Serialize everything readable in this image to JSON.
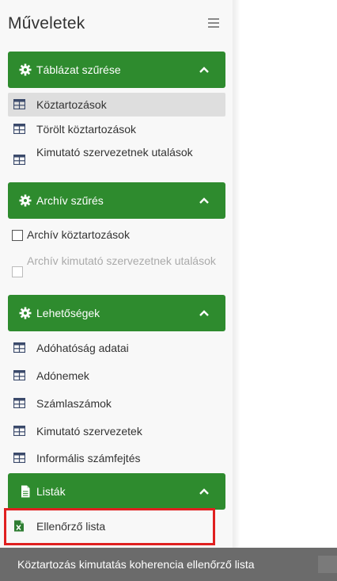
{
  "panel": {
    "title": "Műveletek"
  },
  "sections": {
    "table_filter": {
      "label": "Táblázat szűrése",
      "items": [
        "Köztartozások",
        "Törölt köztartozások",
        "Kimutató szervezetnek utalások"
      ]
    },
    "archive_filter": {
      "label": "Archív szűrés",
      "items": [
        "Archív köztartozások",
        "Archív kimutató szervezetnek utalások"
      ]
    },
    "options": {
      "label": "Lehetőségek",
      "items": [
        "Adóhatóság adatai",
        "Adónemek",
        "Számlaszámok",
        "Kimutató szervezetek",
        "Informális számfejtés"
      ]
    },
    "lists": {
      "label": "Listák",
      "items": [
        "Ellenőrző lista"
      ]
    }
  },
  "tooltip": {
    "text": "Köztartozás kimutatás koherencia ellenőrző lista"
  },
  "colors": {
    "accent_green": "#2e8b2e",
    "highlight_red": "#e02020"
  },
  "icons": {
    "section": "gear-icon",
    "lists_section": "file-icon",
    "item": "table-icon",
    "list_item": "excel-file-icon"
  }
}
